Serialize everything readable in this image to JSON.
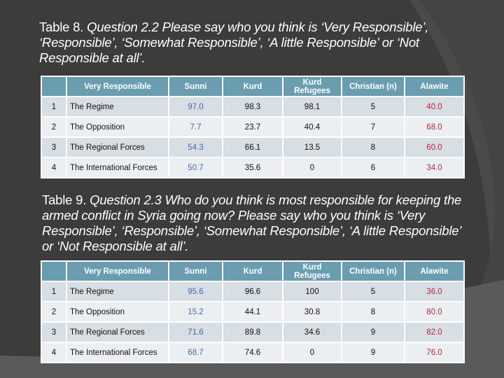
{
  "colors": {
    "background": "#3c3c3c",
    "header_bg": "#6a9db0",
    "row_odd_bg": "#d7dee4",
    "row_even_bg": "#ebeff2",
    "sunni_text": "#4a66a8",
    "alawite_text": "#b8263a"
  },
  "table8": {
    "caption_prefix": "Table 8. ",
    "caption_question": "Question 2.2 Please say who you think is ‘Very Responsible’, ‘Responsible’, ‘Somewhat Responsible’, ‘A little Responsible’ or ‘Not Responsible at all’.",
    "headers": [
      "",
      "Very Responsible",
      "Sunni",
      "Kurd",
      "Kurd Refugees",
      "Christian (n)",
      "Alawite"
    ],
    "rows": [
      {
        "num": "1",
        "label": "The Regime",
        "sunni": "97.0",
        "kurd": "98.3",
        "kurd_refugees": "98.1",
        "christian": "5",
        "alawite": "40.0"
      },
      {
        "num": "2",
        "label": "The Opposition",
        "sunni": "7.7",
        "kurd": "23.7",
        "kurd_refugees": "40.4",
        "christian": "7",
        "alawite": "68.0"
      },
      {
        "num": "3",
        "label": "The Regional Forces",
        "sunni": "54.3",
        "kurd": "66.1",
        "kurd_refugees": "13.5",
        "christian": "8",
        "alawite": "60.0"
      },
      {
        "num": "4",
        "label": "The International Forces",
        "sunni": "50.7",
        "kurd": "35.6",
        "kurd_refugees": "0",
        "christian": "6",
        "alawite": "34.0"
      }
    ]
  },
  "table9": {
    "caption_prefix": "Table 9. ",
    "caption_question": "Question 2.3 Who do you think is most responsible for keeping the armed conflict in Syria going now? Please say who you think is ‘Very Responsible’, ‘Responsible’, ‘Somewhat Responsible’, ‘A little Responsible’ or ‘Not Responsible at all’.",
    "headers": [
      "",
      "Very Responsible",
      "Sunni",
      "Kurd",
      "Kurd Refugees",
      "Christian (n)",
      "Alawite"
    ],
    "rows": [
      {
        "num": "1",
        "label": "The Regime",
        "sunni": "95.6",
        "kurd": "96.6",
        "kurd_refugees": "100",
        "christian": "5",
        "alawite": "36.0"
      },
      {
        "num": "2",
        "label": "The Opposition",
        "sunni": "15.2",
        "kurd": "44.1",
        "kurd_refugees": "30.8",
        "christian": "8",
        "alawite": "80.0"
      },
      {
        "num": "3",
        "label": "The Regional Forces",
        "sunni": "71.6",
        "kurd": "89.8",
        "kurd_refugees": "34.6",
        "christian": "9",
        "alawite": "82.0"
      },
      {
        "num": "4",
        "label": "The International Forces",
        "sunni": "68.7",
        "kurd": "74.6",
        "kurd_refugees": "0",
        "christian": "9",
        "alawite": "76.0"
      }
    ]
  }
}
